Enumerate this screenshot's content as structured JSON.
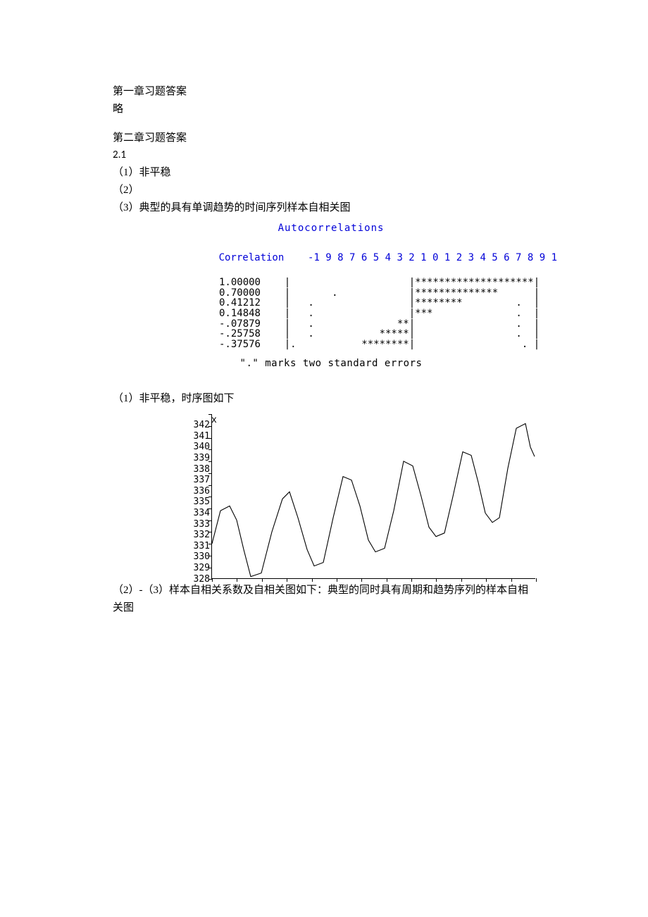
{
  "text": {
    "l1": "第一章习题答案",
    "l2": "略",
    "l3": "第二章习题答案",
    "l4": "2.1",
    "l5": "（1）非平稳",
    "l6": "（2）",
    "l7": "（3）典型的具有单调趋势的时间序列样本自相关图",
    "l8": "（1）非平稳，时序图如下",
    "l9": "（2）-（3）样本自相关系数及自相关图如下：典型的同时具有周期和趋势序列的样本自相",
    "l10": "关图"
  },
  "acf": {
    "title": "Autocorrelations",
    "corr_label": "Correlation",
    "scale": "-1 9 8 7 6 5 4 3 2 1 0 1 2 3 4 5 6 7 8 9 1",
    "footer": "\".\" marks two standard errors"
  },
  "chart_data": {
    "type": "other",
    "title": "Autocorrelations",
    "note": "Sample ACF of a time series with monotonic trend",
    "columns": [
      "value",
      "bar"
    ],
    "rows": [
      {
        "value": "1.00000",
        "bar": "|                    |********************|"
      },
      {
        "value": "0.70000",
        "bar": "|       .            |**************      |"
      },
      {
        "value": "0.41212",
        "bar": "|   .                |********         .  |"
      },
      {
        "value": "0.14848",
        "bar": "|   .                |***              .  |"
      },
      {
        "value": "-.07879",
        "bar": "|   .              **|                 .  |"
      },
      {
        "value": "-.25758",
        "bar": "|   .           *****|                 .  |"
      },
      {
        "value": "-.37576",
        "bar": "|.           ********|                  . |"
      }
    ]
  },
  "ts": {
    "xlabel": "x",
    "y_ticks": [
      "342",
      "341",
      "340",
      "339",
      "338",
      "337",
      "336",
      "335",
      "334",
      "333",
      "332",
      "331",
      "330",
      "329",
      "328"
    ],
    "x_tick_count": 14,
    "series": {
      "name": "x",
      "points": [
        [
          0,
          331
        ],
        [
          12,
          333.8
        ],
        [
          25,
          334.2
        ],
        [
          35,
          333
        ],
        [
          45,
          330.5
        ],
        [
          55,
          328.2
        ],
        [
          70,
          328.5
        ],
        [
          85,
          332
        ],
        [
          100,
          334.8
        ],
        [
          110,
          335.4
        ],
        [
          122,
          333.2
        ],
        [
          135,
          330.5
        ],
        [
          145,
          329.1
        ],
        [
          158,
          329.4
        ],
        [
          172,
          333.2
        ],
        [
          186,
          336.7
        ],
        [
          198,
          336.4
        ],
        [
          210,
          334.2
        ],
        [
          222,
          331.3
        ],
        [
          232,
          330.3
        ],
        [
          245,
          330.6
        ],
        [
          258,
          333.8
        ],
        [
          272,
          338.0
        ],
        [
          285,
          337.6
        ],
        [
          297,
          335
        ],
        [
          308,
          332.4
        ],
        [
          318,
          331.6
        ],
        [
          330,
          331.9
        ],
        [
          342,
          335.0
        ],
        [
          356,
          338.8
        ],
        [
          368,
          338.5
        ],
        [
          378,
          336.2
        ],
        [
          388,
          333.6
        ],
        [
          398,
          332.8
        ],
        [
          408,
          333.2
        ],
        [
          420,
          337.4
        ],
        [
          432,
          340.8
        ],
        [
          445,
          341.2
        ],
        [
          452,
          339.2
        ],
        [
          458,
          338.4
        ]
      ]
    },
    "ylim": [
      328,
      342
    ]
  }
}
